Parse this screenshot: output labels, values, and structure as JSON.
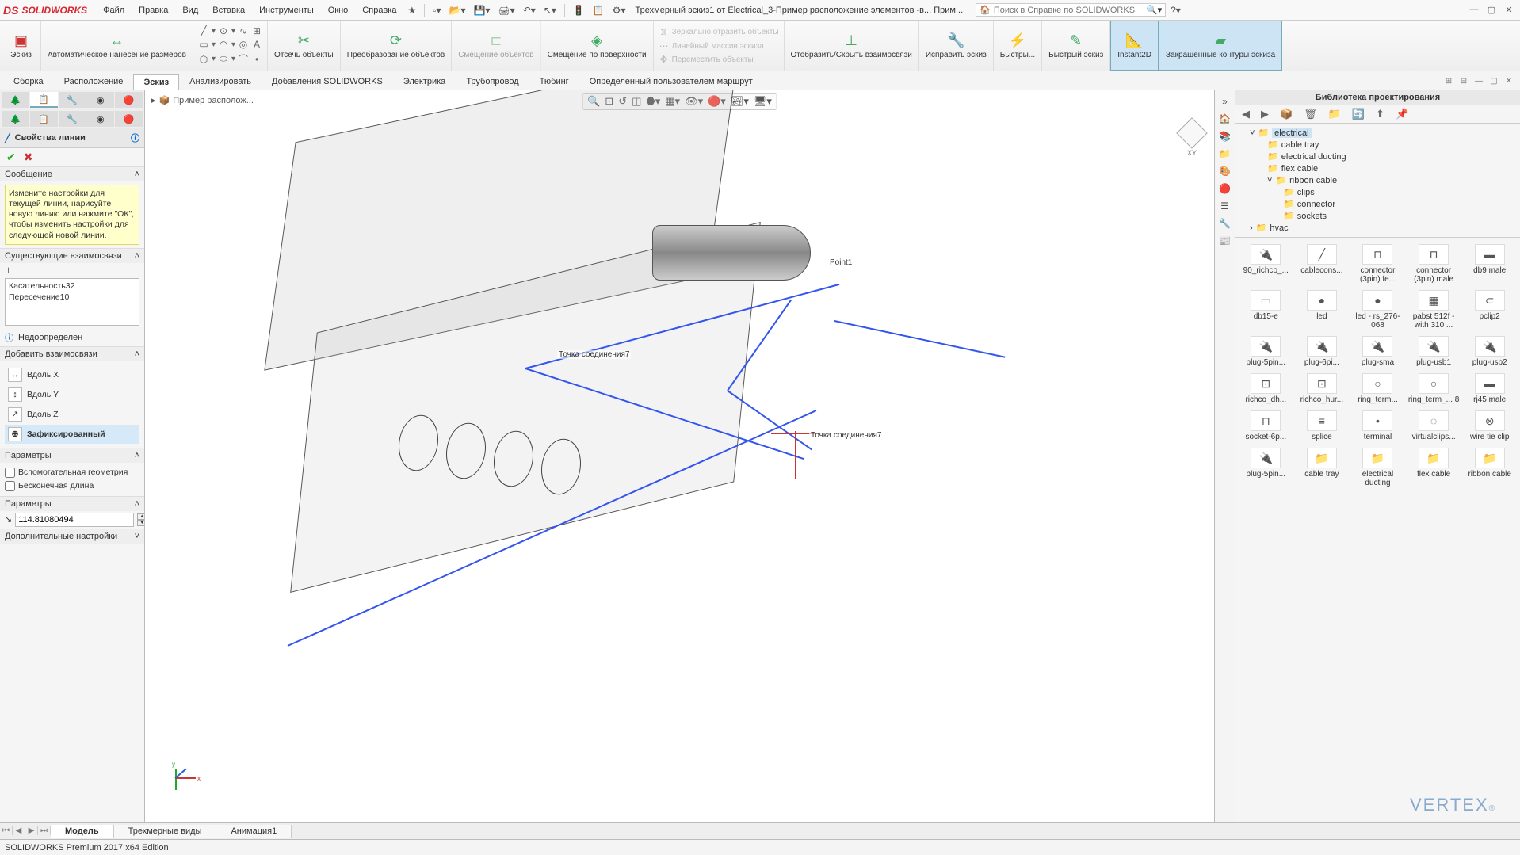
{
  "app": {
    "brand_icon": "DS",
    "brand_text": "SOLIDWORKS"
  },
  "menu": [
    "Файл",
    "Правка",
    "Вид",
    "Вставка",
    "Инструменты",
    "Окно",
    "Справка"
  ],
  "doc_title": "Трехмерный эскиз1 от Electrical_3-Пример расположение элементов -в... Прим...",
  "search_placeholder": "Поиск в Справке по SOLIDWORKS",
  "ribbon": {
    "sketch": "Эскиз",
    "dimension": "Автоматическое нанесение размеров",
    "trim": "Отсечь объекты",
    "convert": "Преобразование объектов",
    "offset": "Смещение объектов",
    "offset_surface": "Смещение по поверхности",
    "mirror": "Зеркально отразить объекты",
    "linear": "Линейный массив эскиза",
    "move": "Переместить объекты",
    "show_rel": "Отобразить/Скрыть взаимосвязи",
    "repair": "Исправить эскиз",
    "rapid": "Быстры...",
    "rapid_sketch": "Быстрый эскиз",
    "instant2d": "Instant2D",
    "shaded": "Закрашенные контуры эскиза"
  },
  "tabs": [
    "Сборка",
    "Расположение",
    "Эскиз",
    "Анализировать",
    "Добавления SOLIDWORKS",
    "Электрика",
    "Трубопровод",
    "Тюбинг",
    "Определенный пользователем маршрут"
  ],
  "active_tab_index": 2,
  "pm": {
    "title": "Свойства линии",
    "sec_msg": "Сообщение",
    "msg": "Измените настройки для текущей линии, нарисуйте новую линию или нажмите \"ОК\", чтобы изменить настройки для следующей новой линии.",
    "sec_existing": "Существующие взаимосвязи",
    "existing": [
      "Касательность32",
      "Пересечение10"
    ],
    "status": "Недоопределен",
    "sec_add": "Добавить взаимосвязи",
    "rel": {
      "along_x": "Вдоль X",
      "along_y": "Вдоль Y",
      "along_z": "Вдоль Z",
      "fixed": "Зафиксированный"
    },
    "sec_params": "Параметры",
    "chk_construction": "Вспомогательная геометрия",
    "chk_infinite": "Бесконечная длина",
    "sec_params2": "Параметры",
    "length_value": "114.81080494",
    "sec_extra": "Дополнительные настройки"
  },
  "breadcrumb": "Пример располож...",
  "canvas_labels": {
    "p1": "Point1",
    "cp1": "Точка соединения7",
    "cp2": "Точка соединения7"
  },
  "orient_label": "XY",
  "right_panel": {
    "title": "Библиотека проектирования",
    "tree": {
      "electrical": "electrical",
      "cable_tray": "cable tray",
      "electrical_ducting": "electrical ducting",
      "flex_cable": "flex cable",
      "ribbon_cable": "ribbon cable",
      "clips": "clips",
      "connector": "connector",
      "sockets": "sockets",
      "hvac": "hvac"
    },
    "items": [
      "90_richco_...",
      "cablecons...",
      "connector (3pin) fe...",
      "connector (3pin) male",
      "db9 male",
      "db15-e",
      "led",
      "led - rs_276-068",
      "pabst 512f - with 310 ...",
      "pclip2",
      "plug-5pin...",
      "plug-6pi...",
      "plug-sma",
      "plug-usb1",
      "plug-usb2",
      "richco_dh...",
      "richco_hur...",
      "ring_term...",
      "ring_term_... 8",
      "rj45 male",
      "socket-6p...",
      "splice",
      "terminal",
      "virtualclips...",
      "wire tie clip",
      "plug-5pin...",
      "cable tray",
      "electrical ducting",
      "flex cable",
      "ribbon cable"
    ]
  },
  "vertex_logo": "VERTEX",
  "doc_tabs": [
    "Модель",
    "Трехмерные виды",
    "Анимация1"
  ],
  "active_doc_tab": 0,
  "status": "SOLIDWORKS Premium 2017 x64 Edition"
}
